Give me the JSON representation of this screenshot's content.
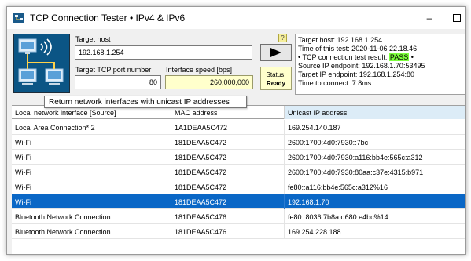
{
  "window": {
    "title": "TCP Connection Tester • IPv4 & IPv6",
    "minimize": "–"
  },
  "inputs": {
    "target_host_label": "Target host",
    "target_host_value": "192.168.1.254",
    "port_label": "Target TCP port number",
    "port_value": "80",
    "speed_label": "Interface speed [bps]",
    "speed_value": "260,000,000",
    "help": "?"
  },
  "status": {
    "label": "Status:",
    "value": "Ready"
  },
  "info": {
    "line1": "Target host: 192.168.1.254",
    "line2": "Time of this test: 2020-11-06 22.18.46",
    "line3_prefix": "• TCP connection test result: ",
    "line3_result": "PASS",
    "line3_suffix": " •",
    "line4": "Source IP endpoint: 192.168.1.70:53495",
    "line5": "Target IP endpoint: 192.168.1.254:80",
    "line6": "Time to connect: 7.8ms"
  },
  "tooltip": "Return network interfaces with unicast IP addresses",
  "table": {
    "columns": [
      "Local network interface [Source]",
      "MAC address",
      "Unicast IP address"
    ],
    "rows": [
      [
        "Local Area Connection* 2",
        "1A1DEAA5C472",
        "169.254.140.187"
      ],
      [
        "Wi-Fi",
        "181DEAA5C472",
        "2600:1700:4d0:7930::7bc"
      ],
      [
        "Wi-Fi",
        "181DEAA5C472",
        "2600:1700:4d0:7930:a116:bb4e:565c:a312"
      ],
      [
        "Wi-Fi",
        "181DEAA5C472",
        "2600:1700:4d0:7930:80aa:c37e:4315:b971"
      ],
      [
        "Wi-Fi",
        "181DEAA5C472",
        "fe80::a116:bb4e:565c:a312%16"
      ],
      [
        "Wi-Fi",
        "181DEAA5C472",
        "192.168.1.70"
      ],
      [
        "Bluetooth Network Connection",
        "181DEAA5C476",
        "fe80::8036:7b8a:d680:e4bc%14"
      ],
      [
        "Bluetooth Network Connection",
        "181DEAA5C476",
        "169.254.228.188"
      ]
    ],
    "selected_row": 5
  },
  "colors": {
    "selection": "#0a67c6",
    "pass": "#7cff3c",
    "status_bg": "#ffffcc"
  }
}
